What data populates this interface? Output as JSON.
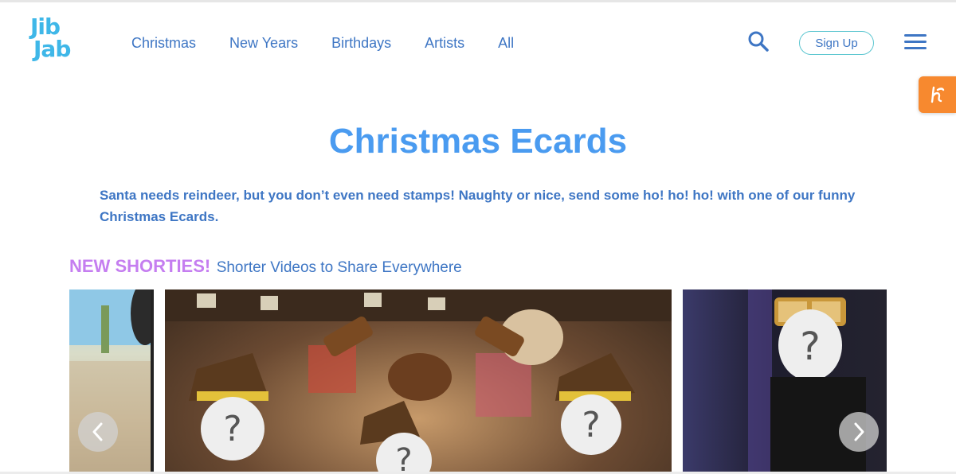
{
  "brand": {
    "logo_line1": "Jib",
    "logo_line2": "Jab"
  },
  "nav": {
    "items": [
      {
        "label": "Christmas"
      },
      {
        "label": "New Years"
      },
      {
        "label": "Birthdays"
      },
      {
        "label": "Artists"
      },
      {
        "label": "All"
      }
    ]
  },
  "header": {
    "signup_label": "Sign Up"
  },
  "page": {
    "title": "Christmas Ecards",
    "description": "Santa needs reindeer, but you don’t even need stamps! Naughty or nice, send some ho! ho! ho! with one of our funny Christmas Ecards."
  },
  "section": {
    "highlight": "NEW SHORTIES!",
    "subtitle": "Shorter Videos to Share Everywhere"
  },
  "colors": {
    "brand_blue": "#3e76c4",
    "title_blue": "#4a9bf0",
    "logo_cyan": "#3fb7e8",
    "shorties_purple": "#c57ef0",
    "honey_orange": "#f7892f"
  },
  "icons": {
    "search": "search-icon",
    "menu": "hamburger-menu-icon",
    "honey": "honey-extension-icon",
    "prev": "chevron-left-icon",
    "next": "chevron-right-icon"
  }
}
